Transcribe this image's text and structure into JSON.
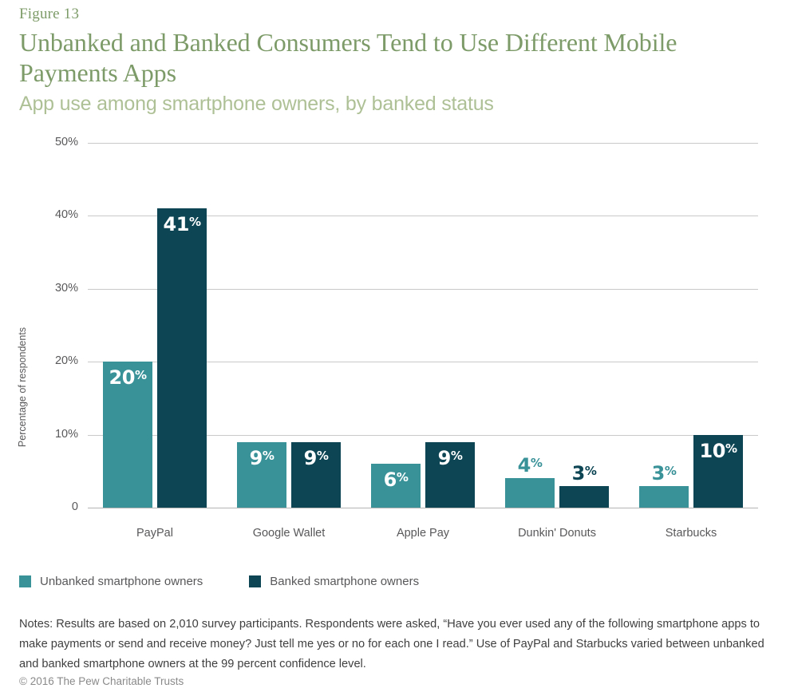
{
  "header": {
    "figure_number": "Figure 13",
    "title": "Unbanked and Banked Consumers Tend to Use Different Mobile Payments Apps",
    "subtitle": "App use among smartphone owners, by banked status"
  },
  "footer": {
    "notes": "Notes: Results are based on 2,010 survey participants. Respondents were asked, “Have you ever used any of the following smartphone apps to make payments or send and receive money? Just tell me yes or no for each one I read.” Use of PayPal and Starbucks varied between unbanked and banked smartphone owners at the 99 percent confidence level.",
    "copyright": "© 2016 The Pew Charitable Trusts"
  },
  "colors": {
    "unbanked": "#3a9299",
    "banked": "#0d4554",
    "title_green": "#7d9b68",
    "subtitle_green": "#aec196",
    "gridline": "#c9c9c9",
    "text": "#58585a"
  },
  "chart_data": {
    "type": "bar",
    "title": "Unbanked and Banked Consumers Tend to Use Different Mobile Payments Apps",
    "subtitle": "App use among smartphone owners, by banked status",
    "xlabel": "",
    "ylabel": "Percentage of respondents",
    "ylim": [
      0,
      50
    ],
    "ytick_labels": [
      "0",
      "10%",
      "20%",
      "30%",
      "40%",
      "50%"
    ],
    "ytick_values": [
      0,
      10,
      20,
      30,
      40,
      50
    ],
    "grid": true,
    "legend_position": "bottom-left",
    "categories": [
      "PayPal",
      "Google Wallet",
      "Apple Pay",
      "Dunkin' Donuts",
      "Starbucks"
    ],
    "series": [
      {
        "name": "Unbanked smartphone owners",
        "color": "#3a9299",
        "values": [
          20,
          9,
          6,
          4,
          3
        ],
        "value_labels": [
          "20%",
          "9%",
          "6%",
          "4%",
          "3%"
        ],
        "label_placement": [
          "inside",
          "inside",
          "inside",
          "above",
          "above"
        ]
      },
      {
        "name": "Banked smartphone owners",
        "color": "#0d4554",
        "values": [
          41,
          9,
          9,
          3,
          10
        ],
        "value_labels": [
          "41%",
          "9%",
          "9%",
          "3%",
          "10%"
        ],
        "label_placement": [
          "inside",
          "inside",
          "inside",
          "above",
          "inside"
        ]
      }
    ]
  }
}
